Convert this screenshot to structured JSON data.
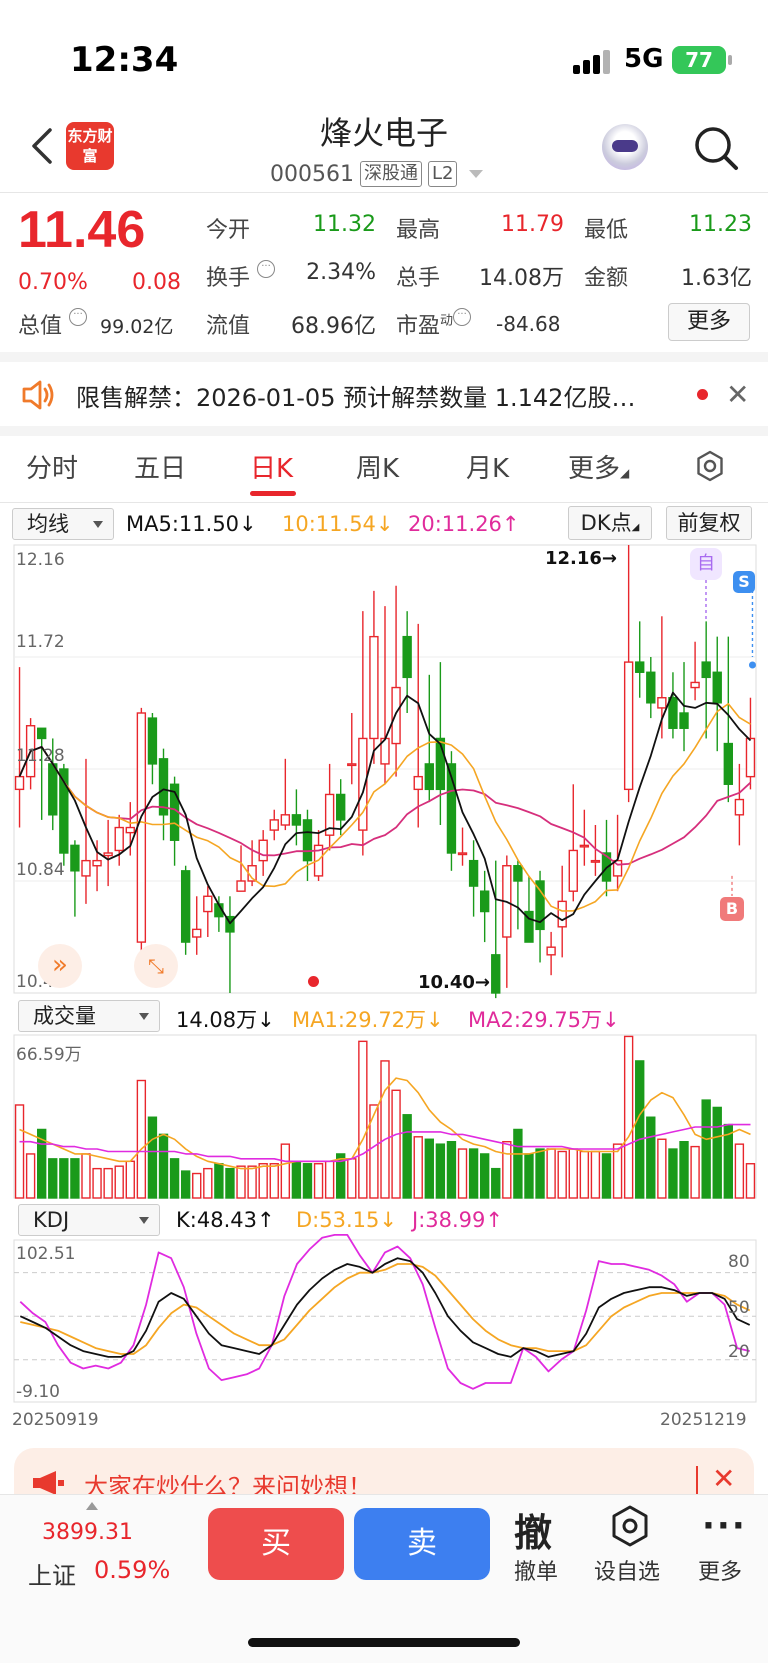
{
  "status": {
    "time": "12:34",
    "network": "5G",
    "battery": "77"
  },
  "header": {
    "title": "烽火电子",
    "code": "000561",
    "market_tag": "深股通",
    "level_tag": "L2",
    "logo_text": "东方财富"
  },
  "quote": {
    "price": "11.46",
    "change_pct": "0.70%",
    "change_val": "0.08",
    "stats": [
      {
        "label": "今开",
        "value": "11.32",
        "color": "green"
      },
      {
        "label": "最高",
        "value": "11.79",
        "color": "red"
      },
      {
        "label": "最低",
        "value": "11.23",
        "color": "green"
      },
      {
        "label": "换手",
        "value": "2.34%",
        "color": "dark"
      },
      {
        "label": "总手",
        "value": "14.08万",
        "color": "dark"
      },
      {
        "label": "金额",
        "value": "1.63亿",
        "color": "dark"
      },
      {
        "label": "流值",
        "value": "68.96亿",
        "color": "dark"
      }
    ],
    "total_value_label": "总值",
    "total_value": "99.02亿",
    "pe_label": "市盈",
    "pe_sup": "动",
    "pe_value": "-84.68",
    "more_label": "更多"
  },
  "notice": {
    "text": "限售解禁：2026-01-05 预计解禁数量 1.142亿股…"
  },
  "tabs": [
    {
      "label": "分时"
    },
    {
      "label": "五日"
    },
    {
      "label": "日K"
    },
    {
      "label": "周K"
    },
    {
      "label": "月K"
    },
    {
      "label": "更多"
    }
  ],
  "ma_row": {
    "selector": "均线",
    "ma5": "MA5:11.50",
    "ma10": "10:11.54",
    "ma20": "20:11.26",
    "dk_label": "DK点",
    "adjust_label": "前复权"
  },
  "kline": {
    "y_labels": [
      "12.16",
      "11.72",
      "11.28",
      "10.84",
      "10.40"
    ],
    "max_marker": "12.16→",
    "min_marker": "10.40→",
    "self_marker": "自",
    "s_marker": "S",
    "b_marker": "B"
  },
  "vol_row": {
    "selector": "成交量",
    "vol": "14.08万",
    "ma1": "MA1:29.72万",
    "ma2": "MA2:29.75万",
    "max_label": "66.59万"
  },
  "kdj_row": {
    "selector": "KDJ",
    "k": "K:48.43",
    "d": "D:53.15",
    "j": "J:38.99",
    "y_max": "102.51",
    "y_min": "-9.10",
    "lvl_80": "80",
    "lvl_50": "50",
    "lvl_20": "20",
    "date_start": "20250919",
    "date_end": "20251219"
  },
  "banner": {
    "text": "大家在炒什么？来问妙想！"
  },
  "bottom": {
    "index_value": "3899.31",
    "index_name": "上证",
    "index_pct": "0.59%",
    "buy": "买",
    "sell": "卖",
    "cancel_glyph": "撤",
    "cancel_label": "撤单",
    "watch_label": "设自选",
    "more_label": "更多"
  },
  "colors": {
    "up": "#e8262c",
    "down": "#1a9a1a",
    "ma5": "#111111",
    "ma10": "#f5a623",
    "ma20": "#d62f7c",
    "kdj_j": "#e02be0"
  },
  "chart_data": {
    "type": "candlestick",
    "price_range": [
      10.4,
      12.16
    ],
    "candles": [
      [
        11.2,
        11.25,
        11.05,
        11.68
      ],
      [
        11.25,
        11.45,
        11.2,
        11.48
      ],
      [
        11.44,
        11.4,
        11.08,
        11.42
      ],
      [
        11.3,
        11.1,
        11.04,
        11.4
      ],
      [
        11.28,
        10.95,
        10.9,
        11.3
      ],
      [
        10.98,
        10.88,
        10.7,
        11.0
      ],
      [
        10.86,
        10.92,
        10.75,
        11.32
      ],
      [
        10.9,
        10.92,
        10.8,
        11.0
      ],
      [
        10.94,
        10.95,
        10.82,
        11.08
      ],
      [
        10.96,
        11.05,
        10.9,
        11.1
      ],
      [
        11.03,
        11.05,
        10.94,
        11.15
      ],
      [
        10.6,
        11.5,
        10.45,
        11.52
      ],
      [
        11.48,
        11.3,
        11.22,
        11.5
      ],
      [
        11.32,
        11.1,
        11.0,
        11.36
      ],
      [
        11.22,
        11.0,
        10.9,
        11.25
      ],
      [
        10.88,
        10.6,
        10.55,
        10.9
      ],
      [
        10.62,
        10.65,
        10.55,
        10.78
      ],
      [
        10.72,
        10.78,
        10.62,
        10.82
      ],
      [
        10.75,
        10.7,
        10.64,
        10.78
      ],
      [
        10.7,
        10.64,
        10.4,
        10.78
      ],
      [
        10.8,
        10.84,
        10.8,
        10.98
      ],
      [
        10.84,
        10.9,
        10.82,
        11.0
      ],
      [
        10.92,
        11.0,
        10.86,
        11.04
      ],
      [
        11.04,
        11.08,
        11.0,
        11.12
      ],
      [
        11.06,
        11.1,
        11.04,
        11.32
      ],
      [
        11.1,
        11.06,
        10.98,
        11.2
      ],
      [
        11.08,
        10.92,
        10.84,
        11.12
      ],
      [
        10.86,
        10.98,
        10.84,
        11.04
      ],
      [
        11.02,
        11.18,
        10.96,
        11.3
      ],
      [
        11.18,
        11.08,
        11.02,
        11.24
      ],
      [
        11.3,
        11.3,
        11.22,
        11.5
      ],
      [
        11.04,
        11.4,
        10.94,
        11.9
      ],
      [
        11.4,
        11.8,
        11.3,
        11.98
      ],
      [
        11.3,
        11.4,
        11.22,
        11.92
      ],
      [
        11.38,
        11.6,
        11.25,
        12.0
      ],
      [
        11.8,
        11.64,
        11.5,
        11.9
      ],
      [
        11.2,
        11.25,
        11.05,
        11.85
      ],
      [
        11.3,
        11.2,
        11.15,
        11.65
      ],
      [
        11.4,
        11.2,
        11.06,
        11.7
      ],
      [
        11.3,
        10.95,
        10.88,
        11.35
      ],
      [
        10.95,
        10.95,
        10.9,
        11.05
      ],
      [
        10.92,
        10.82,
        10.7,
        11.0
      ],
      [
        10.8,
        10.72,
        10.6,
        10.88
      ],
      [
        10.55,
        10.4,
        10.38,
        10.92
      ],
      [
        10.62,
        10.9,
        10.42,
        10.94
      ],
      [
        10.9,
        10.84,
        10.65,
        10.92
      ],
      [
        10.72,
        10.6,
        10.6,
        10.86
      ],
      [
        10.84,
        10.65,
        10.52,
        10.88
      ],
      [
        10.55,
        10.58,
        10.47,
        10.64
      ],
      [
        10.66,
        10.76,
        10.54,
        10.9
      ],
      [
        10.8,
        10.96,
        10.76,
        11.22
      ],
      [
        10.98,
        10.98,
        10.9,
        11.12
      ],
      [
        10.92,
        10.92,
        10.86,
        11.06
      ],
      [
        10.95,
        10.84,
        10.78,
        11.08
      ],
      [
        10.86,
        10.92,
        10.8,
        11.1
      ],
      [
        11.2,
        11.7,
        11.15,
        12.16
      ],
      [
        11.7,
        11.66,
        11.56,
        11.86
      ],
      [
        11.66,
        11.54,
        11.48,
        11.72
      ],
      [
        11.52,
        11.56,
        11.4,
        11.88
      ],
      [
        11.56,
        11.44,
        11.4,
        11.66
      ],
      [
        11.5,
        11.44,
        11.35,
        11.7
      ],
      [
        11.6,
        11.62,
        11.55,
        11.78
      ],
      [
        11.7,
        11.64,
        11.4,
        11.86
      ],
      [
        11.66,
        11.54,
        11.35,
        11.8
      ],
      [
        11.38,
        11.22,
        11.15,
        11.8
      ],
      [
        11.1,
        11.16,
        10.98,
        11.3
      ],
      [
        11.25,
        11.4,
        11.2,
        11.56
      ]
    ],
    "volume_range": [
      0,
      66.59
    ],
    "volumes": [
      38,
      18,
      28,
      16,
      16,
      16,
      18,
      12,
      12,
      13,
      15,
      48,
      33,
      26,
      16,
      11,
      10,
      12,
      14,
      12,
      13,
      13,
      14,
      14,
      22,
      15,
      14,
      14,
      15,
      18,
      16,
      64,
      38,
      56,
      44,
      34,
      25,
      24,
      22,
      23,
      20,
      20,
      18,
      12,
      23,
      28,
      18,
      20,
      20,
      19,
      20,
      19,
      19,
      18,
      22,
      66,
      56,
      33,
      24,
      20,
      23,
      21,
      40,
      37,
      30,
      22,
      14
    ],
    "vol_ma1": [
      28,
      26,
      24,
      22,
      20,
      18,
      18,
      17,
      16,
      15,
      15,
      20,
      24,
      26,
      24,
      20,
      17,
      15,
      14,
      13,
      12,
      12,
      13,
      13,
      14,
      15,
      15,
      15,
      15,
      16,
      16,
      24,
      34,
      44,
      49,
      48,
      43,
      36,
      31,
      28,
      24,
      22,
      21,
      19,
      18,
      18,
      18,
      19,
      20,
      20,
      20,
      19,
      19,
      19,
      19,
      25,
      34,
      40,
      43,
      41,
      34,
      26,
      24,
      25,
      26,
      28,
      26
    ],
    "vol_ma2": [
      23,
      23,
      22,
      22,
      21,
      21,
      20,
      20,
      19,
      19,
      19,
      19,
      19,
      19,
      19,
      18,
      18,
      17,
      17,
      17,
      16,
      16,
      16,
      16,
      15,
      15,
      15,
      15,
      15,
      15,
      16,
      18,
      21,
      24,
      26,
      27,
      27,
      27,
      27,
      26,
      26,
      25,
      24,
      23,
      22,
      21,
      21,
      21,
      21,
      21,
      20,
      20,
      20,
      20,
      20,
      22,
      24,
      25,
      26,
      27,
      28,
      29,
      29,
      29,
      30,
      30,
      30
    ],
    "kdj_range": [
      -9.1,
      102.51
    ],
    "K": [
      50,
      46,
      42,
      36,
      30,
      26,
      24,
      22,
      22,
      26,
      40,
      60,
      66,
      62,
      50,
      38,
      30,
      28,
      26,
      24,
      30,
      44,
      58,
      68,
      76,
      82,
      86,
      84,
      80,
      86,
      90,
      88,
      80,
      66,
      50,
      40,
      32,
      28,
      24,
      22,
      28,
      26,
      22,
      24,
      26,
      38,
      56,
      62,
      66,
      68,
      70,
      70,
      68,
      64,
      66,
      66,
      62,
      48,
      44
    ],
    "D": [
      46,
      44,
      42,
      40,
      36,
      32,
      28,
      26,
      24,
      24,
      30,
      42,
      52,
      58,
      56,
      50,
      44,
      38,
      34,
      30,
      30,
      34,
      44,
      54,
      62,
      70,
      76,
      80,
      80,
      82,
      86,
      86,
      84,
      78,
      68,
      58,
      48,
      40,
      34,
      30,
      28,
      28,
      26,
      26,
      26,
      30,
      40,
      50,
      56,
      60,
      64,
      66,
      66,
      66,
      66,
      66,
      64,
      58,
      54
    ],
    "J": [
      60,
      52,
      46,
      30,
      18,
      14,
      16,
      14,
      18,
      30,
      58,
      94,
      90,
      70,
      38,
      14,
      6,
      8,
      10,
      14,
      30,
      64,
      86,
      96,
      104,
      106,
      106,
      92,
      80,
      94,
      98,
      90,
      72,
      42,
      14,
      4,
      0,
      4,
      4,
      4,
      28,
      22,
      12,
      20,
      26,
      54,
      88,
      86,
      86,
      84,
      82,
      78,
      72,
      60,
      66,
      66,
      58,
      28,
      26
    ],
    "x_labels": [
      "20250919",
      "20251219"
    ]
  }
}
